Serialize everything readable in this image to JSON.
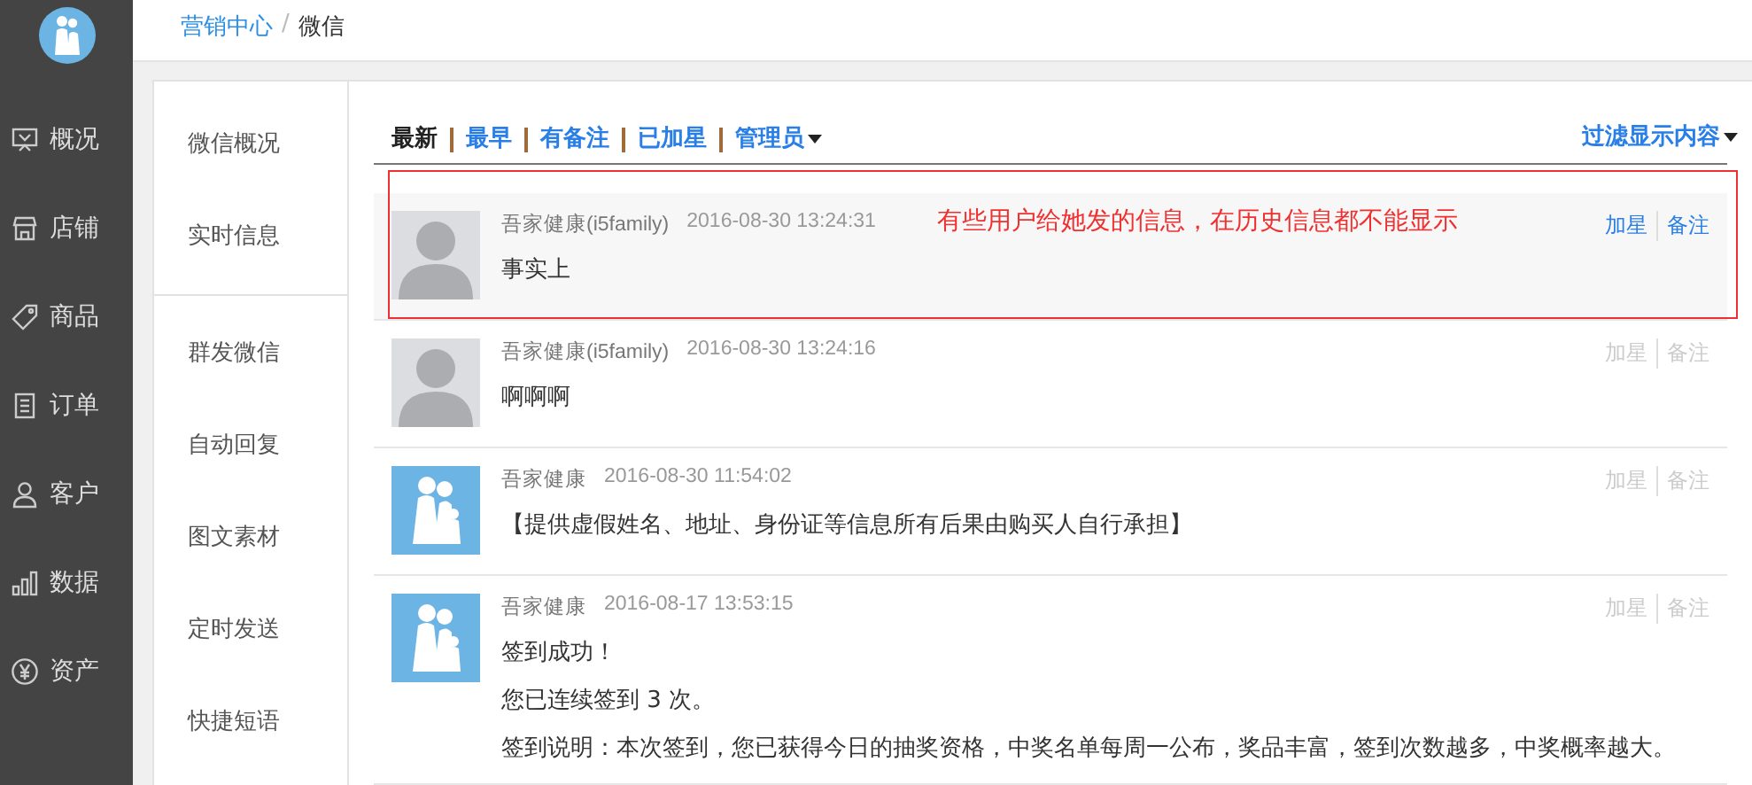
{
  "sidebar": {
    "items": [
      {
        "label": "概况",
        "kind": "overview",
        "selected": false
      },
      {
        "label": "店铺",
        "kind": "store",
        "selected": false
      },
      {
        "label": "商品",
        "kind": "tag",
        "selected": false
      },
      {
        "label": "订单",
        "kind": "list",
        "selected": false
      },
      {
        "label": "客户",
        "kind": "person",
        "selected": false
      },
      {
        "label": "数据",
        "kind": "bars",
        "selected": false
      },
      {
        "label": "资产",
        "kind": "yen",
        "selected": false
      }
    ]
  },
  "breadcrumb": [
    {
      "label": "营销中心",
      "kind": "link"
    },
    {
      "separator": "/",
      "label": "微信",
      "kind": "current"
    }
  ],
  "subnav": {
    "groups": [
      [
        {
          "label": "微信概况"
        },
        {
          "label": "实时信息"
        }
      ],
      [
        {
          "label": "群发微信"
        },
        {
          "label": "自动回复"
        },
        {
          "label": "图文素材"
        },
        {
          "label": "定时发送"
        },
        {
          "label": "快捷短语"
        }
      ]
    ]
  },
  "filters": {
    "tabs": [
      {
        "label": "最新",
        "selected": true,
        "dropdown": false
      },
      {
        "label": "最早",
        "selected": false,
        "dropdown": false
      },
      {
        "label": "有备注",
        "selected": false,
        "dropdown": false
      },
      {
        "label": "已加星",
        "selected": false,
        "dropdown": false
      },
      {
        "label": "管理员",
        "selected": false,
        "dropdown": true
      }
    ],
    "filter_menu": "过滤显示内容"
  },
  "messages": [
    {
      "kind": "default",
      "sender": "吾家健康(i5family)",
      "time": "2016-08-30 13:24:31",
      "highlighted": true,
      "annotation": "有些用户给她发的信息，在历史信息都不能显示",
      "body": [
        "事实上"
      ],
      "actions": [
        "加星",
        "备注"
      ]
    },
    {
      "kind": "default",
      "sender": "吾家健康(i5family)",
      "time": "2016-08-30 13:24:16",
      "highlighted": false,
      "body": [
        "啊啊啊"
      ],
      "actions": [
        "加星",
        "备注"
      ]
    },
    {
      "kind": "family",
      "sender": "吾家健康",
      "time": "2016-08-30 11:54:02",
      "highlighted": false,
      "body": [
        "【提供虚假姓名、地址、身份证等信息所有后果由购买人自行承担】"
      ],
      "actions": [
        "加星",
        "备注"
      ]
    },
    {
      "kind": "family",
      "sender": "吾家健康",
      "time": "2016-08-17 13:53:15",
      "highlighted": false,
      "body": [
        "签到成功！",
        "您已连续签到 3 次。",
        "签到说明：本次签到，您已获得今日的抽奖资格，中奖名单每周一公布，奖品丰富，签到次数越多，中奖概率越大。"
      ],
      "actions": [
        "加星",
        "备注"
      ]
    }
  ]
}
